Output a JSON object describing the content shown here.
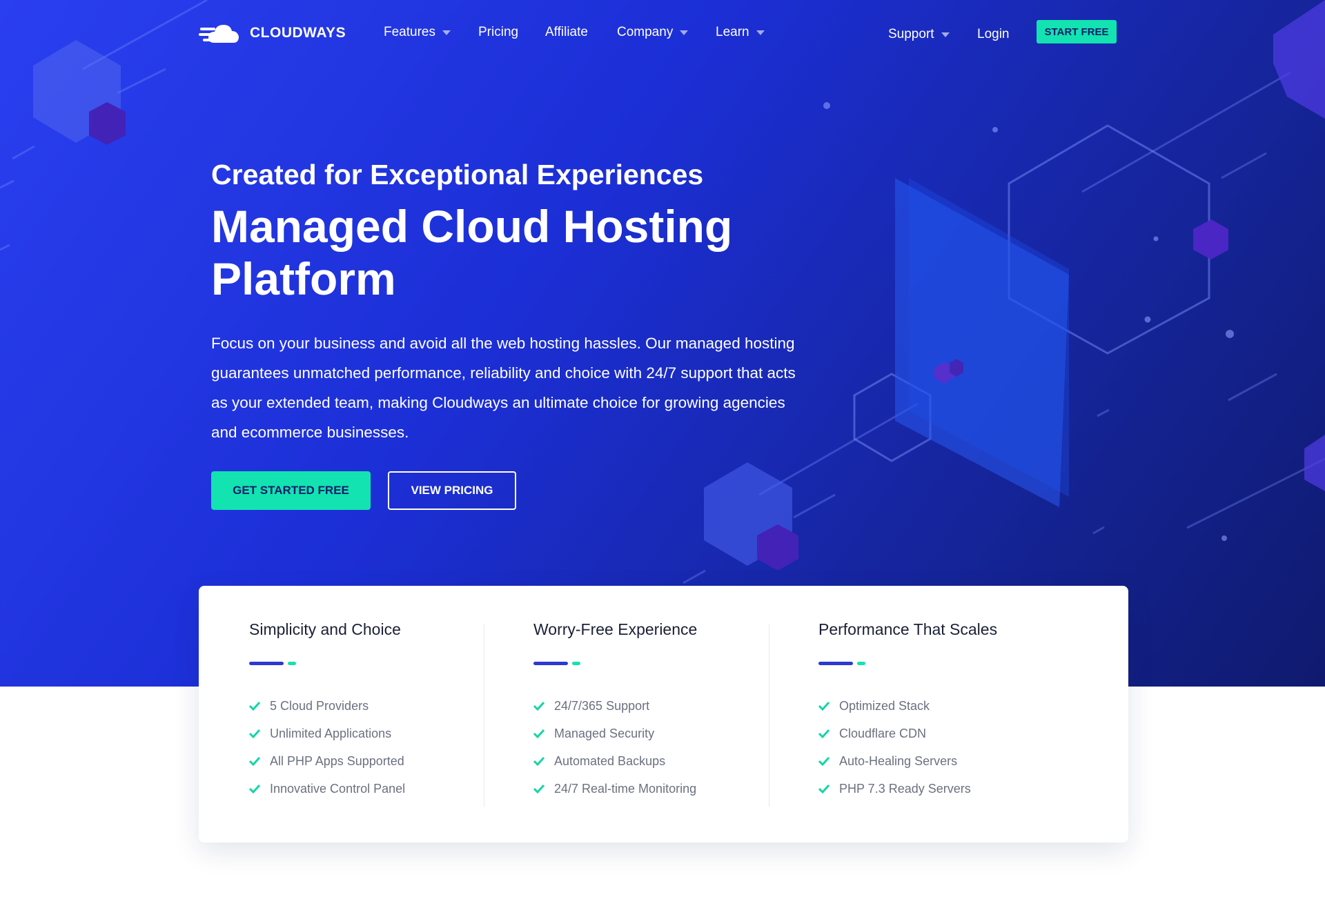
{
  "brand": {
    "name": "CLOUDWAYS",
    "accent": "#13e3b0",
    "hero_blue": "#1c2fd6"
  },
  "nav": {
    "items": [
      {
        "label": "Features",
        "dropdown": true
      },
      {
        "label": "Pricing",
        "dropdown": false
      },
      {
        "label": "Affiliate",
        "dropdown": false
      },
      {
        "label": "Company",
        "dropdown": true
      },
      {
        "label": "Learn",
        "dropdown": true
      }
    ],
    "support": "Support",
    "login": "Login",
    "start_free": "START FREE"
  },
  "hero": {
    "subtitle": "Created for Exceptional Experiences",
    "title": "Managed Cloud Hosting Platform",
    "description": "Focus on your business and avoid all the web hosting hassles. Our managed hosting guarantees unmatched performance, reliability and choice with 24/7 support that acts as your extended team, making Cloudways an ultimate choice for growing agencies and ecommerce businesses.",
    "cta_primary": "GET STARTED FREE",
    "cta_secondary": "VIEW PRICING"
  },
  "features": [
    {
      "title": "Simplicity and Choice",
      "items": [
        "5 Cloud Providers",
        "Unlimited Applications",
        "All PHP Apps Supported",
        "Innovative Control Panel"
      ]
    },
    {
      "title": "Worry-Free Experience",
      "items": [
        "24/7/365 Support",
        "Managed Security",
        "Automated Backups",
        "24/7 Real-time Monitoring"
      ]
    },
    {
      "title": "Performance That Scales",
      "items": [
        "Optimized Stack",
        "Cloudflare CDN",
        "Auto-Healing Servers",
        "PHP 7.3 Ready Servers"
      ]
    }
  ]
}
